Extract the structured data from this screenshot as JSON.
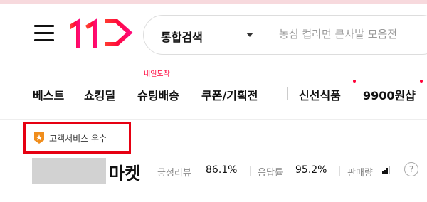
{
  "header": {
    "logo_text": "11",
    "search": {
      "scope": "통합검색",
      "placeholder": "농심 컵라면 큰사발 모음전"
    }
  },
  "nav": {
    "items": [
      "베스트",
      "쇼킹딜",
      "슈팅배송",
      "쿠폰/기획전",
      "신선식품",
      "9900원샵"
    ],
    "badge": "내일도착"
  },
  "seller": {
    "badge": "고객서비스 우수",
    "name": "마켓",
    "stats": [
      {
        "label": "긍정리뷰",
        "value": "86.1%"
      },
      {
        "label": "응답률",
        "value": "95.2%"
      },
      {
        "label": "판매량",
        "value": ""
      }
    ],
    "help": "?"
  },
  "colors": {
    "accent": "#ff0038",
    "highlight_border": "#e60012",
    "badge_orange": "#f08d1c"
  }
}
